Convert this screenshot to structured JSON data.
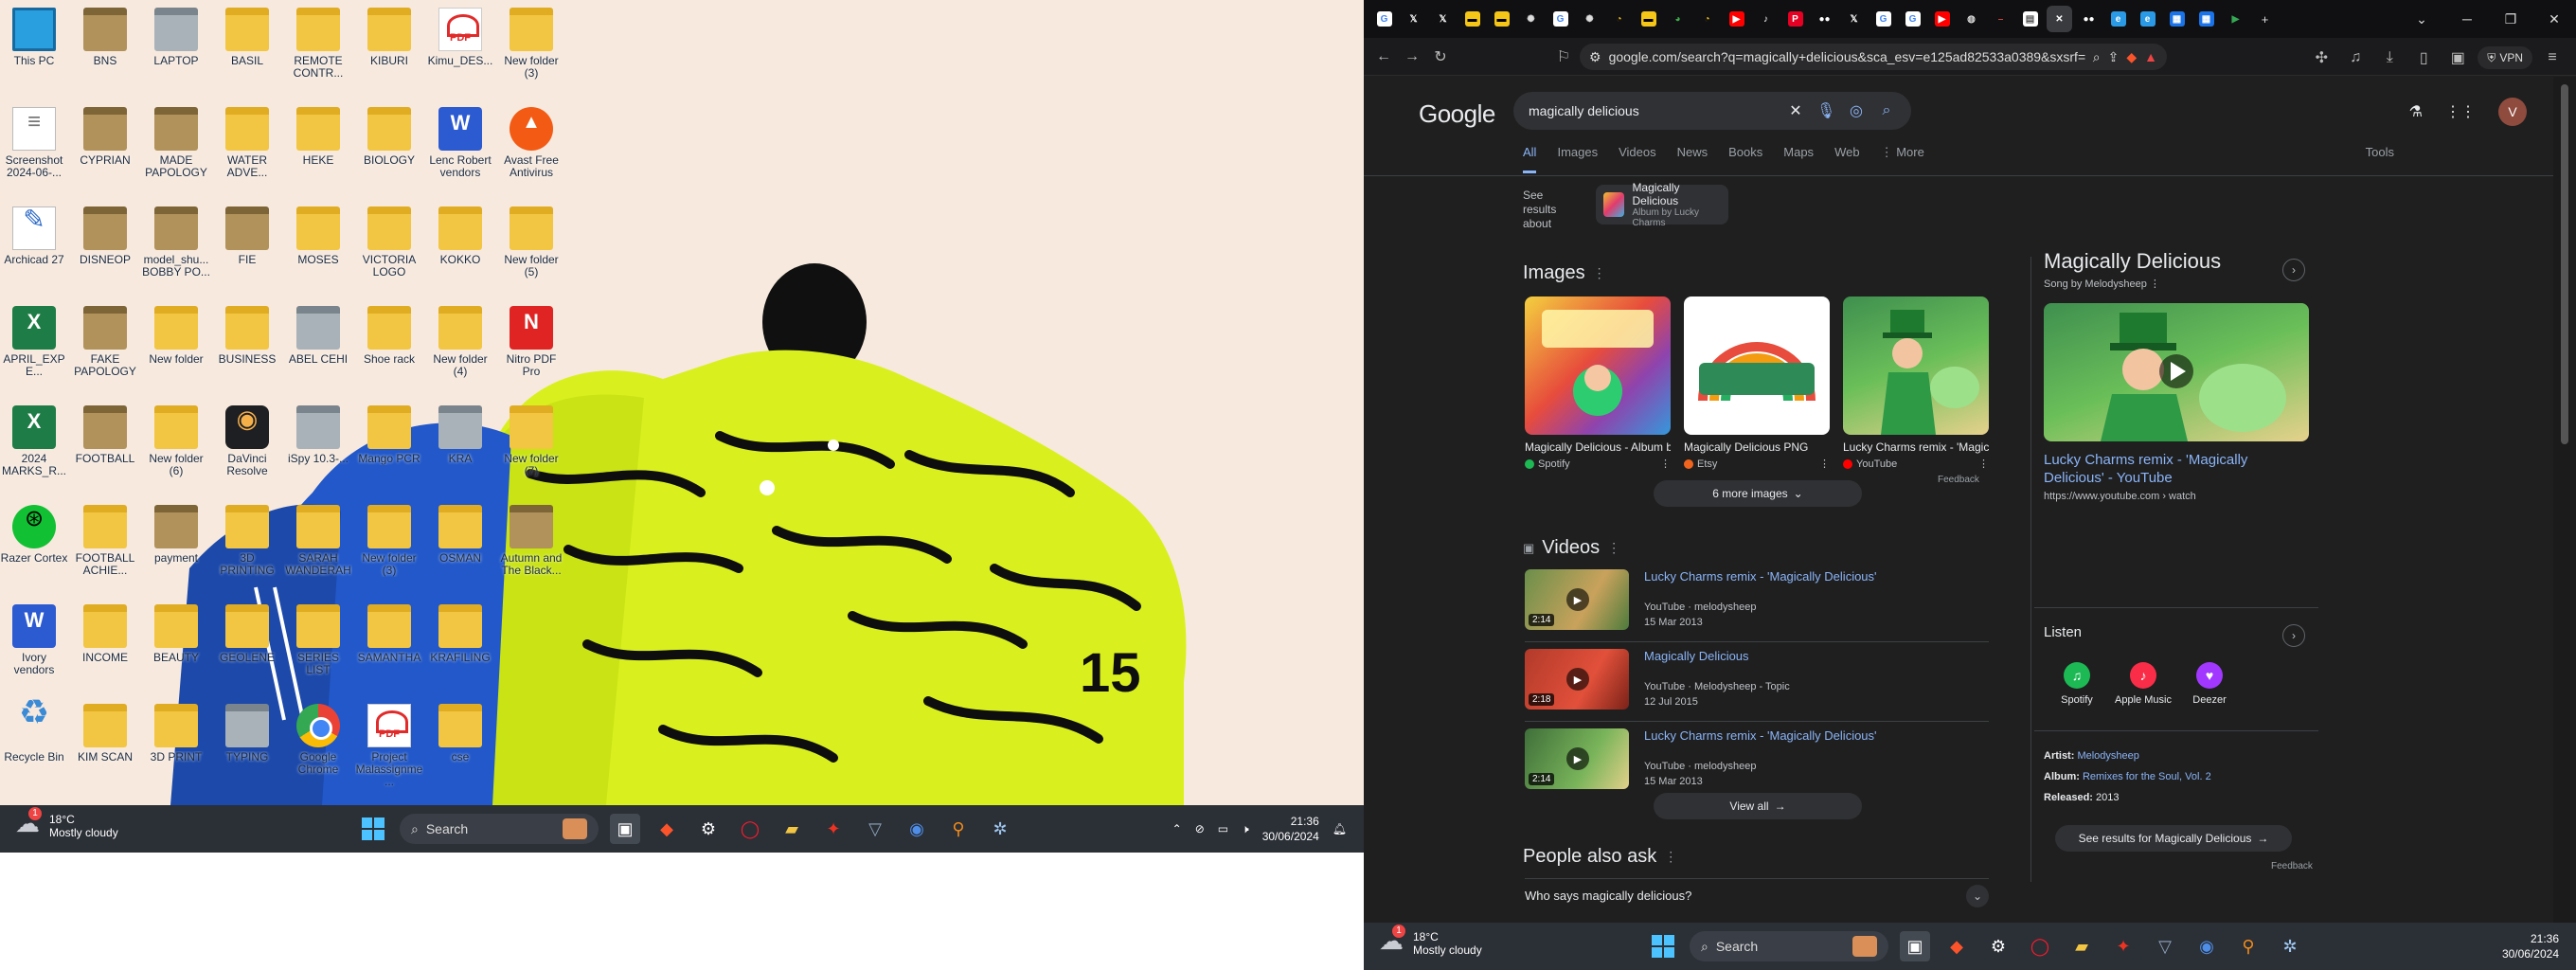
{
  "left": {
    "desktop_icons": [
      {
        "label": "This PC",
        "kind": "pc",
        "col": 0,
        "row": 0
      },
      {
        "label": "BNS",
        "kind": "folder-dark",
        "col": 1,
        "row": 0
      },
      {
        "label": "LAPTOP",
        "kind": "folder-gray",
        "col": 2,
        "row": 0
      },
      {
        "label": "BASIL",
        "kind": "folder",
        "col": 3,
        "row": 0
      },
      {
        "label": "REMOTE CONTR...",
        "kind": "folder",
        "col": 4,
        "row": 0
      },
      {
        "label": "KIBURI",
        "kind": "folder",
        "col": 5,
        "row": 0
      },
      {
        "label": "Kimu_DES...",
        "kind": "pdf",
        "col": 6,
        "row": 0
      },
      {
        "label": "New folder (3)",
        "kind": "folder",
        "col": 7,
        "row": 0
      },
      {
        "label": "Screenshot 2024-06-...",
        "kind": "doc",
        "col": 0,
        "row": 1
      },
      {
        "label": "CYPRIAN",
        "kind": "folder-dark",
        "col": 1,
        "row": 1
      },
      {
        "label": "MADE PAPOLOGY",
        "kind": "folder-dark",
        "col": 2,
        "row": 1
      },
      {
        "label": "WATER ADVE...",
        "kind": "folder",
        "col": 3,
        "row": 1
      },
      {
        "label": "HEKE",
        "kind": "folder",
        "col": 4,
        "row": 1
      },
      {
        "label": "BIOLOGY",
        "kind": "folder",
        "col": 5,
        "row": 1
      },
      {
        "label": "Lenc Robert vendors",
        "kind": "word",
        "col": 6,
        "row": 1
      },
      {
        "label": "Avast Free Antivirus",
        "kind": "orange",
        "col": 7,
        "row": 1
      },
      {
        "label": "Archicad 27",
        "kind": "ahk",
        "col": 0,
        "row": 2
      },
      {
        "label": "DISNEOP",
        "kind": "folder-dark",
        "col": 1,
        "row": 2
      },
      {
        "label": "model_shu... BOBBY PO...",
        "kind": "folder-dark",
        "col": 2,
        "row": 2
      },
      {
        "label": "FIE",
        "kind": "folder-dark",
        "col": 3,
        "row": 2
      },
      {
        "label": "MOSES",
        "kind": "folder",
        "col": 4,
        "row": 2
      },
      {
        "label": "VICTORIA LOGO",
        "kind": "folder",
        "col": 5,
        "row": 2
      },
      {
        "label": "KOKKO",
        "kind": "folder",
        "col": 6,
        "row": 2
      },
      {
        "label": "New folder (5)",
        "kind": "folder",
        "col": 7,
        "row": 2
      },
      {
        "label": "APRIL_EXPE...",
        "kind": "excel",
        "col": 0,
        "row": 3
      },
      {
        "label": "FAKE PAPOLOGY",
        "kind": "folder-dark",
        "col": 1,
        "row": 3
      },
      {
        "label": "New folder",
        "kind": "folder",
        "col": 2,
        "row": 3
      },
      {
        "label": "BUSINESS",
        "kind": "folder",
        "col": 3,
        "row": 3
      },
      {
        "label": "ABEL CEHI",
        "kind": "folder-gray",
        "col": 4,
        "row": 3
      },
      {
        "label": "Shoe rack",
        "kind": "folder",
        "col": 5,
        "row": 3
      },
      {
        "label": "New folder (4)",
        "kind": "folder",
        "col": 6,
        "row": 3
      },
      {
        "label": "Nitro PDF Pro",
        "kind": "nitro",
        "col": 7,
        "row": 3
      },
      {
        "label": "2024 MARKS_R...",
        "kind": "excel",
        "col": 0,
        "row": 4
      },
      {
        "label": "FOOTBALL",
        "kind": "folder-dark",
        "col": 1,
        "row": 4
      },
      {
        "label": "New folder (6)",
        "kind": "folder",
        "col": 2,
        "row": 4
      },
      {
        "label": "DaVinci Resolve",
        "kind": "davinci",
        "col": 3,
        "row": 4
      },
      {
        "label": "iSpy 10.3-...",
        "kind": "folder-gray",
        "col": 4,
        "row": 4
      },
      {
        "label": "Mango PCR",
        "kind": "folder",
        "col": 5,
        "row": 4
      },
      {
        "label": "KRA",
        "kind": "folder-gray",
        "col": 6,
        "row": 4
      },
      {
        "label": "New folder (7)",
        "kind": "folder",
        "col": 7,
        "row": 4
      },
      {
        "label": "Razer Cortex",
        "kind": "razer",
        "col": 0,
        "row": 5
      },
      {
        "label": "FOOTBALL ACHIE...",
        "kind": "folder",
        "col": 1,
        "row": 5
      },
      {
        "label": "payment",
        "kind": "folder-dark",
        "col": 2,
        "row": 5
      },
      {
        "label": "3D PRINTING",
        "kind": "folder",
        "col": 3,
        "row": 5
      },
      {
        "label": "SARAH WANDERAH",
        "kind": "folder",
        "col": 4,
        "row": 5
      },
      {
        "label": "New folder (3)",
        "kind": "folder",
        "col": 5,
        "row": 5
      },
      {
        "label": "OSMAN",
        "kind": "folder",
        "col": 6,
        "row": 5
      },
      {
        "label": "Autumn and The Black...",
        "kind": "folder-dark",
        "col": 7,
        "row": 5
      },
      {
        "label": "Ivory vendors",
        "kind": "word",
        "col": 0,
        "row": 6
      },
      {
        "label": "INCOME",
        "kind": "folder",
        "col": 1,
        "row": 6
      },
      {
        "label": "BEAUTY",
        "kind": "folder",
        "col": 2,
        "row": 6
      },
      {
        "label": "GEOLENE",
        "kind": "folder",
        "col": 3,
        "row": 6
      },
      {
        "label": "SERIES LIST",
        "kind": "folder",
        "col": 4,
        "row": 6
      },
      {
        "label": "SAMANTHA",
        "kind": "folder",
        "col": 5,
        "row": 6
      },
      {
        "label": "KRAFILING",
        "kind": "folder",
        "col": 6,
        "row": 6
      },
      {
        "label": "Recycle Bin",
        "kind": "recycle",
        "col": 0,
        "row": 7
      },
      {
        "label": "KIM SCAN",
        "kind": "folder",
        "col": 1,
        "row": 7
      },
      {
        "label": "3D PRINT",
        "kind": "folder",
        "col": 2,
        "row": 7
      },
      {
        "label": "TYPING",
        "kind": "folder-gray",
        "col": 3,
        "row": 7
      },
      {
        "label": "Google Chrome",
        "kind": "chrome",
        "col": 4,
        "row": 7
      },
      {
        "label": "Project Malassignme...",
        "kind": "pdf",
        "col": 5,
        "row": 7
      },
      {
        "label": "cse",
        "kind": "folder",
        "col": 6,
        "row": 7
      }
    ],
    "taskbar": {
      "weather_temp": "18°C",
      "weather_desc": "Mostly cloudy",
      "weather_badge": "1",
      "search_label": "Search",
      "time": "21:36",
      "date": "30/06/2024"
    }
  },
  "right": {
    "tabs": [
      {
        "icon": "google-icon",
        "glyph": "G",
        "bg": "#ffffff",
        "fg": "#4285f4"
      },
      {
        "icon": "x-icon",
        "glyph": "𝕏",
        "bg": "transparent",
        "fg": "#ffffff"
      },
      {
        "icon": "x-icon",
        "glyph": "𝕏",
        "bg": "transparent",
        "fg": "#ffffff"
      },
      {
        "icon": "bookmark-icon",
        "glyph": "▬",
        "bg": "#f5c518",
        "fg": "#000"
      },
      {
        "icon": "bookmark-icon",
        "glyph": "▬",
        "bg": "#f5c518",
        "fg": "#000"
      },
      {
        "icon": "openai-icon",
        "glyph": "✺",
        "bg": "transparent",
        "fg": "#ddd"
      },
      {
        "icon": "google-icon",
        "glyph": "G",
        "bg": "#ffffff",
        "fg": "#4285f4"
      },
      {
        "icon": "openai-icon",
        "glyph": "✺",
        "bg": "transparent",
        "fg": "#ddd"
      },
      {
        "icon": "clock-icon",
        "glyph": "◔",
        "bg": "transparent",
        "fg": "#f5c518"
      },
      {
        "icon": "bookmark-icon",
        "glyph": "▬",
        "bg": "#f5c518",
        "fg": "#000"
      },
      {
        "icon": "spot-icon",
        "glyph": "◕",
        "bg": "transparent",
        "fg": "#3dae4b"
      },
      {
        "icon": "clock-icon",
        "glyph": "◔",
        "bg": "transparent",
        "fg": "#f5c518"
      },
      {
        "icon": "youtube-icon",
        "glyph": "▶",
        "bg": "#ff0000",
        "fg": "#fff"
      },
      {
        "icon": "tiktok-icon",
        "glyph": "♪",
        "bg": "transparent",
        "fg": "#fff"
      },
      {
        "icon": "pinterest-icon",
        "glyph": "P",
        "bg": "#e60023",
        "fg": "#fff"
      },
      {
        "icon": "flickr-icon",
        "glyph": "●●",
        "bg": "transparent",
        "fg": "#fff"
      },
      {
        "icon": "x-icon",
        "glyph": "𝕏",
        "bg": "transparent",
        "fg": "#ffffff"
      },
      {
        "icon": "google-icon",
        "glyph": "G",
        "bg": "#ffffff",
        "fg": "#4285f4"
      },
      {
        "icon": "google-icon",
        "glyph": "G",
        "bg": "#ffffff",
        "fg": "#4285f4"
      },
      {
        "icon": "youtube-icon",
        "glyph": "▶",
        "bg": "#ff0000",
        "fg": "#fff"
      },
      {
        "icon": "globe-icon",
        "glyph": "◍",
        "bg": "transparent",
        "fg": "#ddd"
      },
      {
        "icon": "dash-icon",
        "glyph": "–",
        "bg": "transparent",
        "fg": "#c44"
      },
      {
        "icon": "doc-icon",
        "glyph": "▤",
        "bg": "#ffffff",
        "fg": "#555"
      },
      {
        "icon": "close-icon",
        "glyph": "✕",
        "bg": "transparent",
        "fg": "#fff",
        "active": true
      },
      {
        "icon": "flickr-icon",
        "glyph": "●●",
        "bg": "transparent",
        "fg": "#fff"
      },
      {
        "icon": "edge-icon",
        "glyph": "e",
        "bg": "#2b9ae6",
        "fg": "#fff"
      },
      {
        "icon": "edge-icon",
        "glyph": "e",
        "bg": "#2b9ae6",
        "fg": "#fff"
      },
      {
        "icon": "calendar-icon",
        "glyph": "▦",
        "bg": "#1a73e8",
        "fg": "#fff"
      },
      {
        "icon": "calendar-icon",
        "glyph": "▦",
        "bg": "#1a73e8",
        "fg": "#fff"
      },
      {
        "icon": "play-store-icon",
        "glyph": "▶",
        "bg": "transparent",
        "fg": "#34a853"
      }
    ],
    "url": "google.com/search?q=magically+delicious&sca_esv=e125ad82533a0389&sxsrf=...",
    "vpn_label": "VPN",
    "logo": "Google",
    "query": "magically delicious",
    "avatar_letter": "V",
    "search_tabs": [
      "All",
      "Images",
      "Videos",
      "News",
      "Books",
      "Maps",
      "Web",
      "More"
    ],
    "tools_label": "Tools",
    "see_results_label": "See results about",
    "about_title": "Magically Delicious",
    "about_sub": "Album by Lucky Charms",
    "images_heading": "Images",
    "images": [
      {
        "caption": "Magically Delicious - Album b...",
        "source": "Spotify",
        "dot": "#1db954"
      },
      {
        "caption": "Magically Delicious PNG",
        "source": "Etsy",
        "dot": "#f1641e"
      },
      {
        "caption": "Lucky Charms remix - 'Magic...",
        "source": "YouTube",
        "dot": "#ff0000"
      }
    ],
    "more_images_label": "6 more images",
    "feedback_label": "Feedback",
    "videos_heading": "Videos",
    "videos": [
      {
        "title": "Lucky Charms remix - 'Magically Delicious'",
        "meta": "YouTube · melodysheep",
        "date": "15 Mar 2013",
        "duration": "2:14"
      },
      {
        "title": "Magically Delicious",
        "meta": "YouTube · Melodysheep - Topic",
        "date": "12 Jul 2015",
        "duration": "2:18"
      },
      {
        "title": "Lucky Charms remix - 'Magically Delicious'",
        "meta": "YouTube · melodysheep",
        "date": "15 Mar 2013",
        "duration": "2:14"
      }
    ],
    "view_all_label": "View all",
    "paa_heading": "People also ask",
    "paa_question": "Who says magically delicious?",
    "kp": {
      "title": "Magically Delicious",
      "subtitle": "Song by Melodysheep",
      "link_title": "Lucky Charms remix - 'Magically Delicious' - YouTube",
      "link_url": "https://www.youtube.com › watch",
      "listen_heading": "Listen",
      "services": [
        {
          "name": "Spotify",
          "color": "#1db954",
          "glyph": "♫"
        },
        {
          "name": "Apple Music",
          "color": "#fa2d48",
          "glyph": "♪"
        },
        {
          "name": "Deezer",
          "color": "#a238ff",
          "glyph": "♥"
        }
      ],
      "artist_label": "Artist:",
      "artist": "Melodysheep",
      "album_label": "Album:",
      "album": "Remixes for the Soul, Vol. 2",
      "released_label": "Released:",
      "released": "2013",
      "see_results_btn": "See results for Magically Delicious",
      "feedback_label": "Feedback"
    },
    "taskbar": {
      "weather_temp": "18°C",
      "weather_desc": "Mostly cloudy",
      "weather_badge": "1",
      "search_label": "Search",
      "time": "21:36",
      "date": "30/06/2024"
    }
  }
}
